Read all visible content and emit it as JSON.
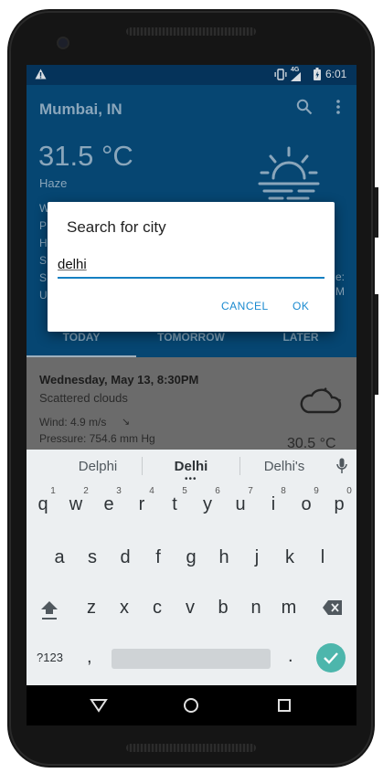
{
  "status": {
    "alert_icon": "warning-icon",
    "time": "6:01",
    "network": "4G"
  },
  "app": {
    "city": "Mumbai, IN",
    "temperature": "31.5 °C",
    "condition": "Haze",
    "menu_icon": "more-vert-icon",
    "search_icon": "search-icon"
  },
  "side_labels": [
    "W",
    "P",
    "H",
    "S",
    "S",
    "U"
  ],
  "side_right": [
    "e:",
    "M"
  ],
  "tabs": [
    "TODAY",
    "TOMORROW",
    "LATER"
  ],
  "forecast": {
    "datetime": "Wednesday, May 13, 8:30PM",
    "description": "Scattered clouds",
    "wind": "Wind: 4.9 m/s",
    "wind_arrow": "↘",
    "pressure": "Pressure: 754.6 mm Hg",
    "temperature": "30.5 °C"
  },
  "dialog": {
    "title": "Search for city",
    "value": "delhi",
    "cancel": "CANCEL",
    "ok": "OK"
  },
  "keyboard": {
    "suggestions": [
      "Delphi",
      "Delhi",
      "Delhi's"
    ],
    "row1": [
      "q",
      "w",
      "e",
      "r",
      "t",
      "y",
      "u",
      "i",
      "o",
      "p"
    ],
    "row1_hints": [
      "1",
      "2",
      "3",
      "4",
      "5",
      "6",
      "7",
      "8",
      "9",
      "0"
    ],
    "row2": [
      "a",
      "s",
      "d",
      "f",
      "g",
      "h",
      "j",
      "k",
      "l"
    ],
    "row3": [
      "z",
      "x",
      "c",
      "v",
      "b",
      "n",
      "m"
    ],
    "symbols": "?123",
    "comma": ",",
    "period": "."
  },
  "colors": {
    "accent": "#1a8ad0",
    "enter": "#4db6ac",
    "appbar": "#0b6fb5"
  }
}
